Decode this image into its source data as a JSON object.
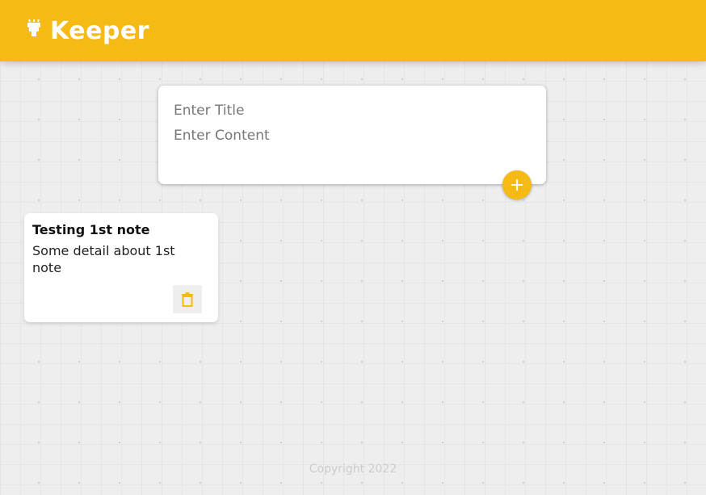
{
  "header": {
    "title": "Keeper",
    "logo_icon": "highlighter-icon"
  },
  "create_note": {
    "title_placeholder": "Enter Title",
    "content_placeholder": "Enter Content",
    "add_icon": "plus-icon"
  },
  "notes": [
    {
      "title": "Testing 1st note",
      "content": "Some detail about 1st\nnote",
      "delete_icon": "trash-icon"
    }
  ],
  "footer": {
    "copyright": "Copyright 2022"
  },
  "colors": {
    "accent": "#f5ba13",
    "background": "#eeeeee",
    "card": "#ffffff",
    "footer_text": "#cccccc"
  }
}
